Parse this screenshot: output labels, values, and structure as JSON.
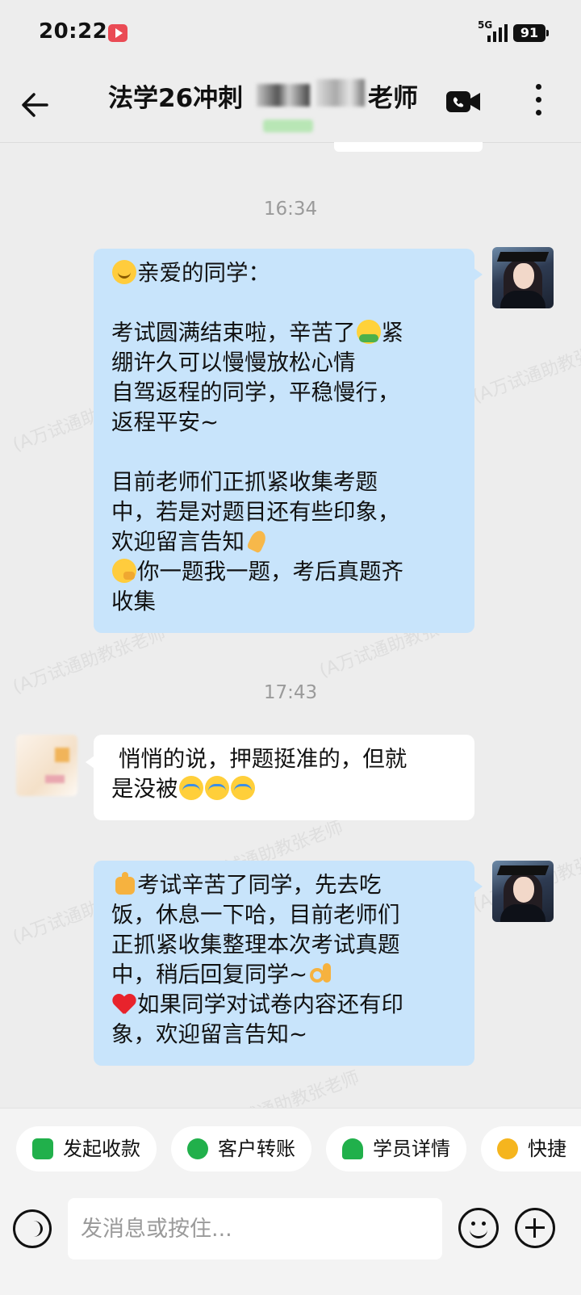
{
  "status_bar": {
    "time": "20:22",
    "network": "5G",
    "battery": "91"
  },
  "header": {
    "title_prefix": "法学26冲刺",
    "title_suffix": "老师"
  },
  "watermark_text": "(A万试通助教张老师",
  "messages": [
    {
      "timestamp": "16:34",
      "direction": "outgoing",
      "lines": [
        {
          "emoji": "smile",
          "text": "亲爱的同学："
        },
        {
          "text": ""
        },
        {
          "text": "考试圆满结束啦，辛苦了",
          "emoji_after": "hug",
          "tail": "紧"
        },
        {
          "text": "绷许久可以慢慢放松心情"
        },
        {
          "text": "自驾返程的同学，平稳慢行，"
        },
        {
          "text": "返程平安~"
        },
        {
          "text": ""
        },
        {
          "text": "目前老师们正抓紧收集考题"
        },
        {
          "text": "中，若是对题目还有些印象，"
        },
        {
          "text": "欢迎留言告知",
          "emoji_after": "pray"
        },
        {
          "emoji": "think",
          "text": "你一题我一题，考后真题齐"
        },
        {
          "text": "收集"
        }
      ]
    },
    {
      "timestamp": "17:43",
      "direction": "incoming",
      "lines": [
        {
          "text": " 悄悄的说，押题挺准的，但就"
        },
        {
          "text": "是没被",
          "emoji_after": "cry3"
        }
      ]
    },
    {
      "direction": "outgoing",
      "lines": [
        {
          "emoji": "thumb",
          "text": "考试辛苦了同学，先去吃"
        },
        {
          "text": "饭，休息一下哈，目前老师们"
        },
        {
          "text": "正抓紧收集整理本次考试真题"
        },
        {
          "text": "中，稍后回复同学~",
          "emoji_after": "ok"
        },
        {
          "emoji": "heart",
          "text": "如果同学对试卷内容还有印"
        },
        {
          "text": "象，欢迎留言告知~"
        }
      ]
    }
  ],
  "quick_actions": [
    {
      "label": "发起收款",
      "color": "#21b04b"
    },
    {
      "label": "客户转账",
      "color": "#21b04b"
    },
    {
      "label": "学员详情",
      "color": "#21b04b"
    },
    {
      "label": "快捷",
      "color": "#f5b51e"
    }
  ],
  "input": {
    "placeholder": "发消息或按住..."
  }
}
